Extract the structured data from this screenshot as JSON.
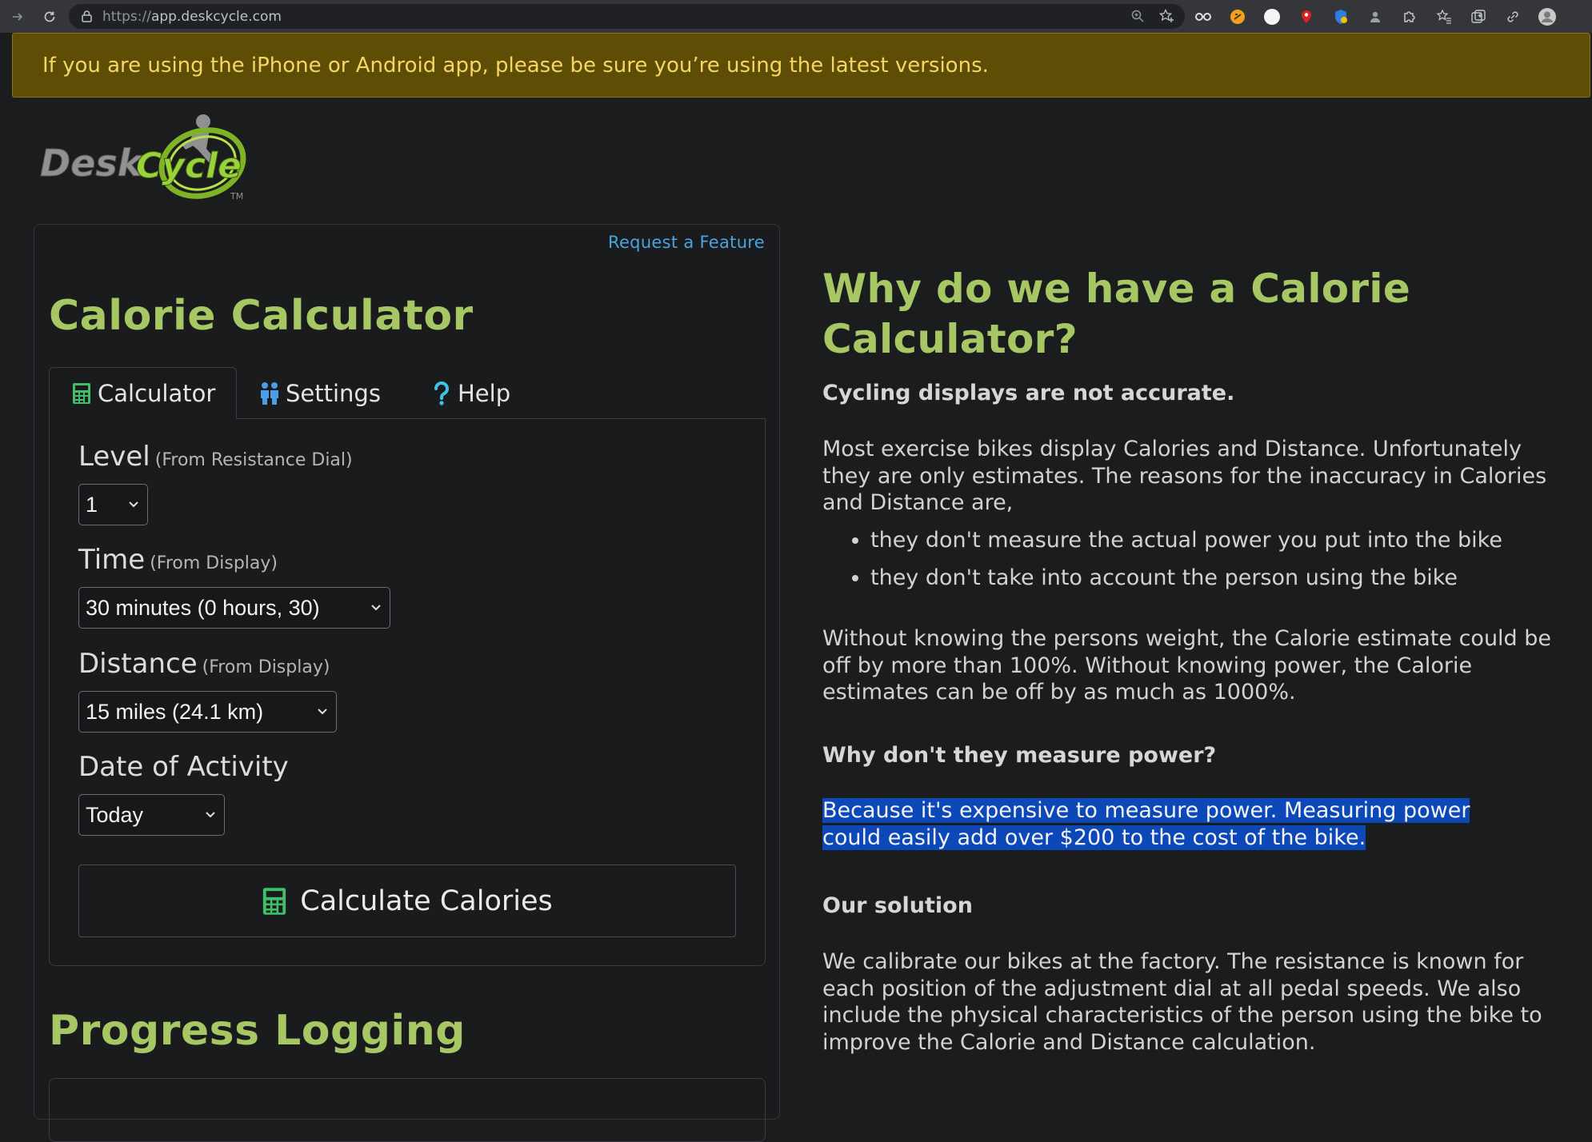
{
  "browser": {
    "url_scheme": "https://",
    "url_host": "app.deskcycle.com"
  },
  "banner": {
    "text": "If you are using the iPhone or Android app, please be sure you’re using the latest versions."
  },
  "calculator": {
    "request_link": "Request a Feature",
    "title": "Calorie Calculator",
    "tabs": [
      {
        "label": "Calculator",
        "icon": "calculator-icon"
      },
      {
        "label": "Settings",
        "icon": "people-icon"
      },
      {
        "label": "Help",
        "icon": "question-icon"
      }
    ],
    "level": {
      "label": "Level",
      "hint": "(From Resistance Dial)",
      "value": "1"
    },
    "time": {
      "label": "Time",
      "hint": "(From Display)",
      "value": "30 minutes (0 hours, 30)"
    },
    "distance": {
      "label": "Distance",
      "hint": "(From Display)",
      "value": "15 miles (24.1 km)"
    },
    "date": {
      "label": "Date of Activity",
      "value": "Today"
    },
    "button_label": "Calculate Calories"
  },
  "progress": {
    "title": "Progress Logging"
  },
  "article": {
    "title": "Why do we have a Calorie Calculator?",
    "subhead1": "Cycling displays are not accurate.",
    "para1": "Most exercise bikes display Calories and Distance. Unfortunately they are only estimates. The reasons for the inaccuracy in Calories and Distance are,",
    "bullets": [
      "they don't measure the actual power you put into the bike",
      "they don't take into account the person using the bike"
    ],
    "para2": "Without knowing the persons weight, the Calorie estimate could be off by more than 100%. Without knowing power, the Calorie estimates can be off by as much as 1000%.",
    "subhead2": "Why don't they measure power?",
    "para3": "Because it's expensive to measure power. Measuring power could easily add over $200 to the cost of the bike.",
    "subhead3": "Our solution",
    "para4": "We calibrate our bikes at the factory. The resistance is known for each position of the adjustment dial at all pedal speeds. We also include the physical characteristics of the person using the bike to improve the Calorie and Distance calculation."
  },
  "colors": {
    "accent_green": "#a6c764",
    "link_blue": "#4aa3df",
    "banner_bg": "#5e4d04",
    "banner_text": "#f4d667",
    "highlight": "#0c48b8"
  }
}
